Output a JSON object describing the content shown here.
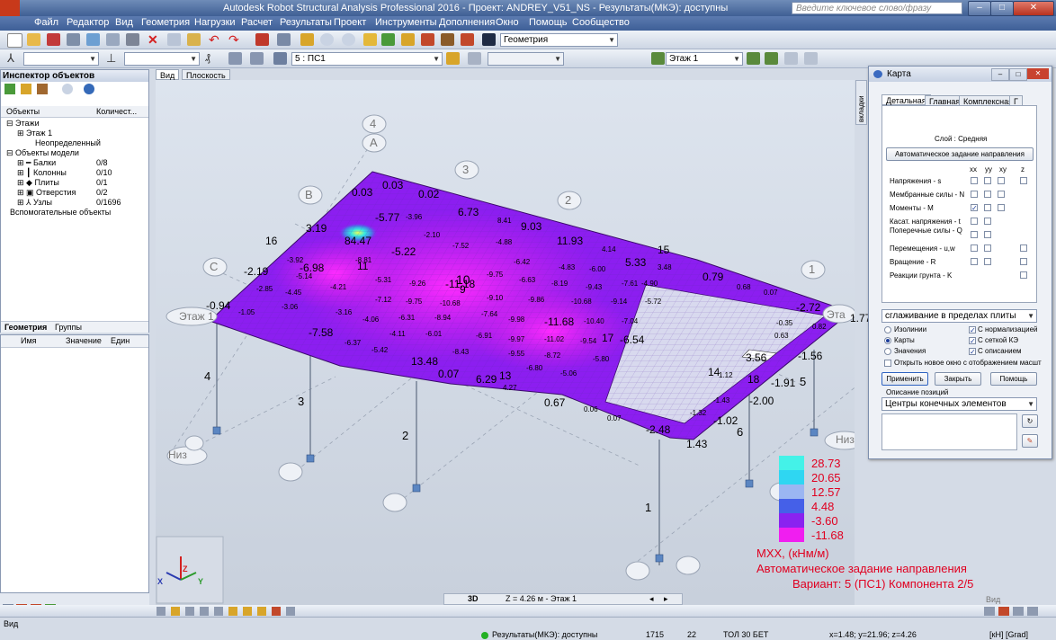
{
  "window": {
    "title": "Autodesk Robot Structural Analysis Professional 2016 - Проект: ANDREY_V51_NS - Результаты(МКЭ): доступны",
    "search_placeholder": "Введите ключевое слово/фразу"
  },
  "menu": [
    "Файл",
    "Редактор",
    "Вид",
    "Геометрия",
    "Нагрузки",
    "Расчет",
    "Результаты",
    "Проект",
    "Инструменты",
    "Дополнения",
    "Окно",
    "Помощь",
    "Сообщество"
  ],
  "toolbar": {
    "layout_combo": "Геометрия",
    "case_combo": "5 : ПС1",
    "storey_combo": "Этаж 1"
  },
  "inspector": {
    "title": "Инспектор объектов",
    "col_objects": "Объекты",
    "col_count": "Количест...",
    "tree": [
      {
        "label": "Этажи",
        "count": ""
      },
      {
        "label": "Этаж 1",
        "count": ""
      },
      {
        "label": "Неопределенный",
        "count": ""
      },
      {
        "label": "Объекты модели",
        "count": ""
      },
      {
        "label": "Балки",
        "count": "0/8"
      },
      {
        "label": "Колонны",
        "count": "0/10"
      },
      {
        "label": "Плиты",
        "count": "0/1"
      },
      {
        "label": "Отверстия",
        "count": "0/2"
      },
      {
        "label": "Узлы",
        "count": "0/1696"
      },
      {
        "label": "Вспомогательные объекты",
        "count": ""
      }
    ],
    "tabs": [
      "Геометрия",
      "Группы"
    ],
    "props_cols": [
      "Имя",
      "Значение",
      "Един"
    ]
  },
  "view_tabs": [
    "Вид",
    "Плоскость"
  ],
  "side_tab": "вкладки",
  "map_values": {
    "plate": [
      "0.03",
      "0.03",
      "0.02",
      "6.73",
      "8.41",
      "9.03",
      "11.93",
      "4.14",
      "5.33",
      "3.48",
      "3.19",
      "84.47",
      "-5.77",
      "-3.96",
      "-2.10",
      "-7.52",
      "-4.88",
      "-5.22",
      "-6.98",
      "-8.81",
      "-6.42",
      "-4.83",
      "-6.00",
      "-7.61",
      "-4.90",
      "-2.19",
      "-3.92",
      "-5.14",
      "-4.45",
      "-2.85",
      "-4.21",
      "-5.31",
      "-9.26",
      "-11.18",
      "-9.75",
      "-6.63",
      "-8.19",
      "-9.43",
      "-5.72",
      "-0.94",
      "-3.06",
      "-1.05",
      "-7.12",
      "-9.75",
      "-10.68",
      "-9.10",
      "-9.86",
      "-10.68",
      "-9.14",
      "-4.06",
      "-3.16",
      "-6.31",
      "-8.94",
      "-7.64",
      "-9.98",
      "-11.68",
      "-10.40",
      "-7.04",
      "-7.58",
      "-4.11",
      "-6.01",
      "-6.91",
      "-9.97",
      "-11.02",
      "-9.54",
      "-6.54",
      "-6.37",
      "-5.42",
      "13.48",
      "-8.43",
      "-9.55",
      "-8.72",
      "0.07",
      "6.29",
      "4.27",
      "-6.80",
      "-5.06",
      "-5.80"
    ],
    "strip": [
      "0.79",
      "0.68",
      "0.07",
      "-2.72",
      "-0.35",
      "0.82",
      "0.63",
      "1.77",
      "3.56",
      "-1.56",
      "-1.91",
      "1.12",
      "-1.43",
      "-2.00",
      "-1.02",
      "-1.32",
      "1.43",
      "0.67",
      "0.06",
      "0.07",
      "-2.48"
    ]
  },
  "axis_labels": [
    "4",
    "A",
    "3",
    "2",
    "B",
    "1",
    "C",
    "15",
    "16",
    "13",
    "11",
    "9",
    "10",
    "17",
    "14",
    "18",
    "4",
    "3",
    "2",
    "1",
    "6",
    "5",
    "Этаж 1",
    "Низ",
    "Низ",
    "Эта"
  ],
  "karta": {
    "title": "Карта",
    "tabs": [
      "Детальная",
      "Главная",
      "Комплексная",
      "Г"
    ],
    "layer": "Слой : Средняя",
    "auto_dir_button": "Автоматическое задание направления",
    "col_headers": [
      "xx",
      "yy",
      "xy",
      "z"
    ],
    "rows": [
      {
        "label": "Напряжения - s",
        "checks": [
          false,
          false,
          false,
          false
        ]
      },
      {
        "label": "Мембранные силы - N",
        "checks": [
          false,
          false,
          false
        ]
      },
      {
        "label": "Моменты - M",
        "checks": [
          true,
          false,
          false
        ]
      },
      {
        "label": "Касат. напряжения - t",
        "checks": [
          false,
          false
        ]
      },
      {
        "label": "Поперечные силы - Q",
        "checks": [
          false,
          false
        ]
      },
      {
        "label": "Перемещения - u,w",
        "checks": [
          false,
          false,
          false
        ]
      },
      {
        "label": "Вращение - R",
        "checks": [
          false,
          false,
          false
        ]
      },
      {
        "label": "Реакции грунта - K",
        "checks": [
          false
        ]
      }
    ],
    "smoothing": "сглаживание в пределах плиты",
    "radio": [
      {
        "label": "Изолинии",
        "checked": false
      },
      {
        "label": "Карты",
        "checked": true
      },
      {
        "label": "Значения",
        "checked": false
      }
    ],
    "options": [
      {
        "label": "С нормализацией",
        "checked": true
      },
      {
        "label": "С сеткой КЭ",
        "checked": true
      },
      {
        "label": "С описанием",
        "checked": true
      }
    ],
    "new_window": "Открыть новое окно с отображением масшт",
    "buttons": [
      "Применить",
      "Закрыть",
      "Помощь"
    ],
    "pos_desc_label": "Описание позиций",
    "pos_desc_value": "Центры конечных элементов"
  },
  "legend": {
    "values": [
      "28.73",
      "20.65",
      "12.57",
      "4.48",
      "-3.60",
      "-11.68"
    ],
    "colors": [
      "#44f2e8",
      "#2fd6f2",
      "#9bb6f2",
      "#4560e8",
      "#8a22f0",
      "#f01ef0"
    ],
    "line1": "MXX, (кНм/м)",
    "line2": "Автоматическое задание направления",
    "line3": "Вариант: 5 (ПС1) Компонента 2/5"
  },
  "view_status": {
    "mode": "3D",
    "level": "Z = 4.26 м - Этаж 1"
  },
  "corner_label": "Вид",
  "status": {
    "left": "Вид",
    "result": "Результаты(МКЭ): доступны",
    "n1": "1715",
    "n2": "22",
    "section": "ТОЛ 30 БЕТ",
    "coords": "x=1.48; y=21.96; z=4.26",
    "units": "[кН] [Grad]"
  }
}
